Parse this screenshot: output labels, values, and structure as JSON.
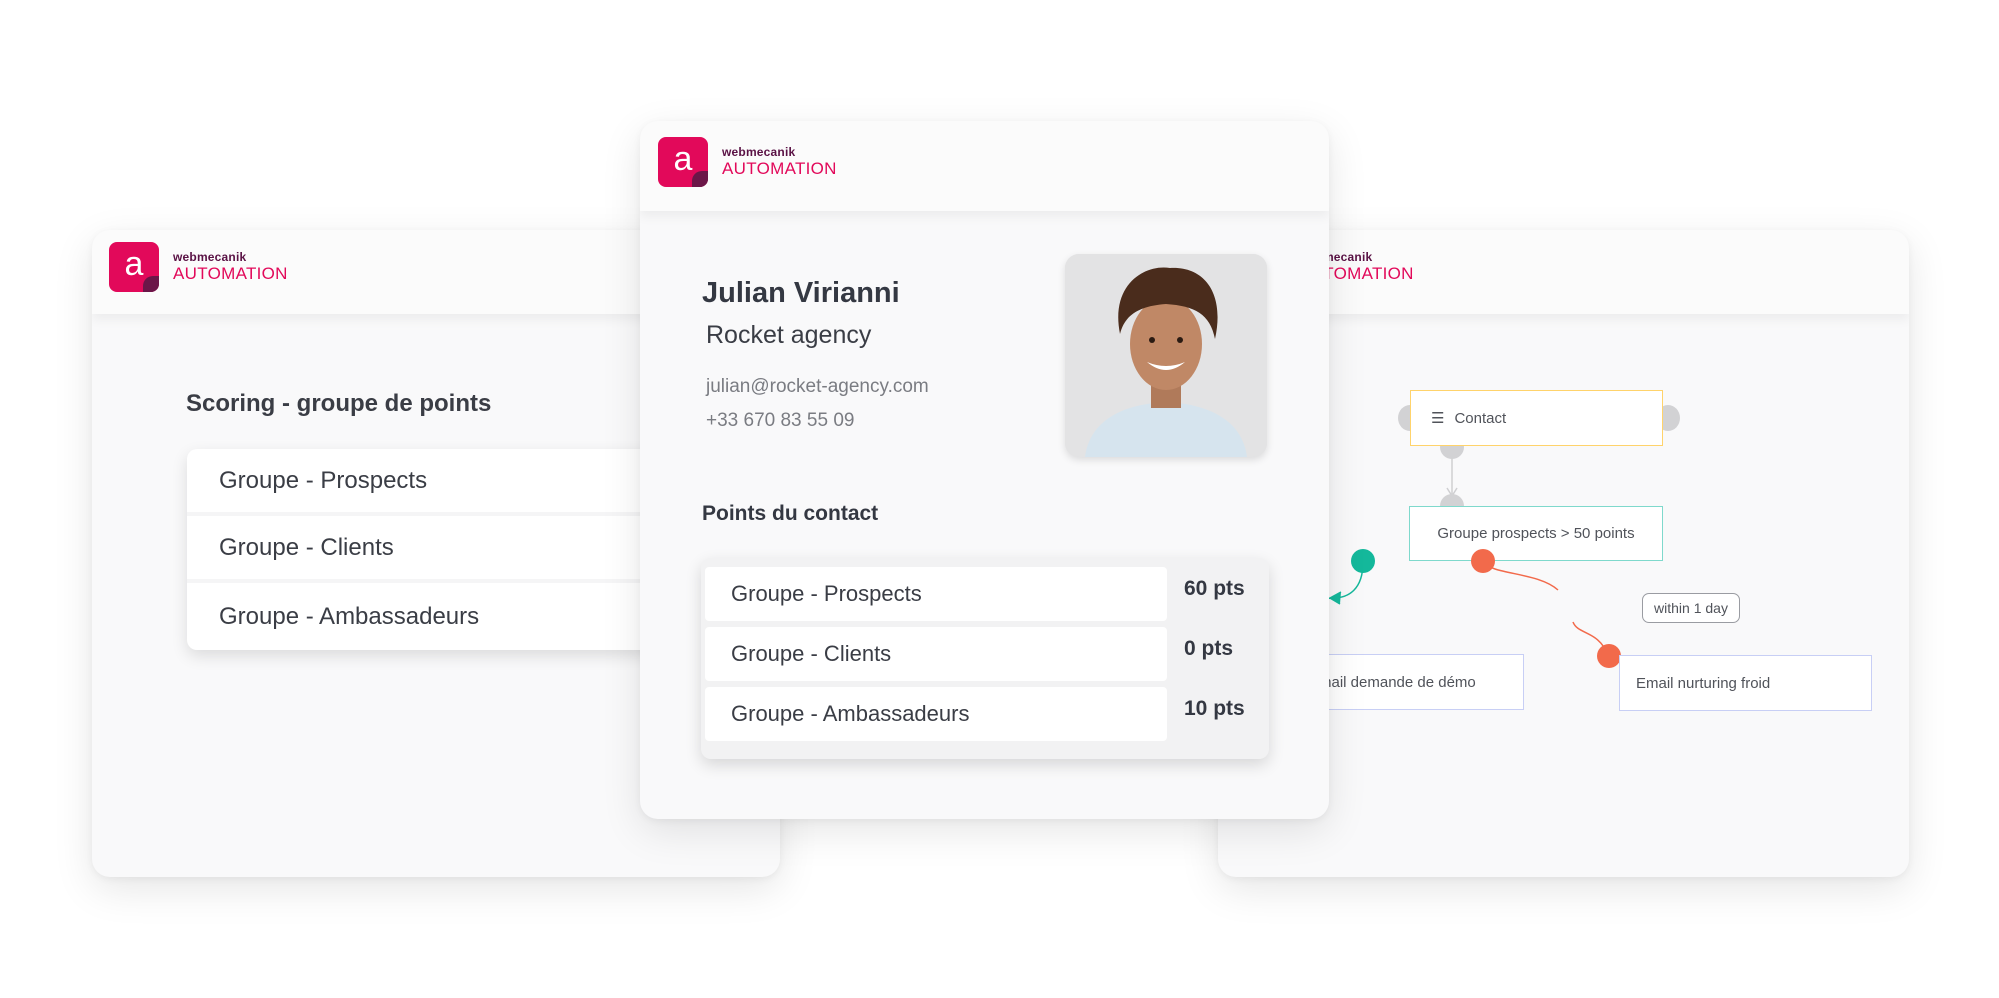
{
  "brand": {
    "company": "webmecanik",
    "product": "AUTOMATION",
    "logo_letter": "a",
    "accent": "#e2095a",
    "dark": "#5a1245"
  },
  "left_card": {
    "title": "Scoring - groupe de points",
    "groups": [
      "Groupe - Prospects",
      "Groupe - Clients",
      "Groupe - Ambassadeurs"
    ]
  },
  "center_card": {
    "name": "Julian Virianni",
    "company": "Rocket agency",
    "email": "julian@rocket-agency.com",
    "phone": "+33 670 83 55 09",
    "points_title": "Points du contact",
    "points": [
      {
        "group": "Groupe - Prospects",
        "points": "60 pts"
      },
      {
        "group": "Groupe - Clients",
        "points": "0 pts"
      },
      {
        "group": "Groupe - Ambassadeurs",
        "points": "10 pts"
      }
    ]
  },
  "right_card": {
    "nodes": {
      "contact": "Contact",
      "condition": "Groupe prospects > 50 points",
      "delay": "within 1 day",
      "email_yes": "Email demande de démo",
      "email_no": "Email nurturing froid"
    },
    "colors": {
      "source": "#ffd36b",
      "condition": "#7fd9cc",
      "action": "#c8cff5",
      "yes": "#14b89b",
      "no": "#f26a4b",
      "port": "#d2d2d4"
    }
  }
}
